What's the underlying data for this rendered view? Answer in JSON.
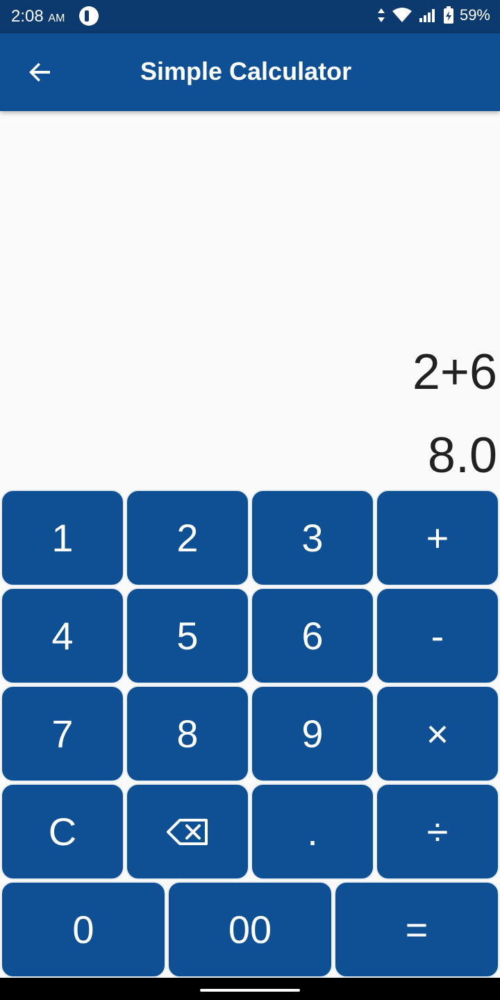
{
  "status_bar": {
    "time": "2:08",
    "ampm": "AM",
    "battery": "59%"
  },
  "app_bar": {
    "title": "Simple Calculator"
  },
  "display": {
    "expression": "2+6",
    "result": "8.0"
  },
  "keypad": {
    "rows": [
      [
        "1",
        "2",
        "3",
        "+"
      ],
      [
        "4",
        "5",
        "6",
        "-"
      ],
      [
        "7",
        "8",
        "9",
        "×"
      ],
      [
        "C",
        "",
        ".",
        "÷"
      ],
      [
        "0",
        "00",
        "="
      ]
    ]
  },
  "colors": {
    "accent": "#0f4f93",
    "status_bar": "#0d3a6e",
    "background": "#fafafa",
    "text": "#212121"
  }
}
